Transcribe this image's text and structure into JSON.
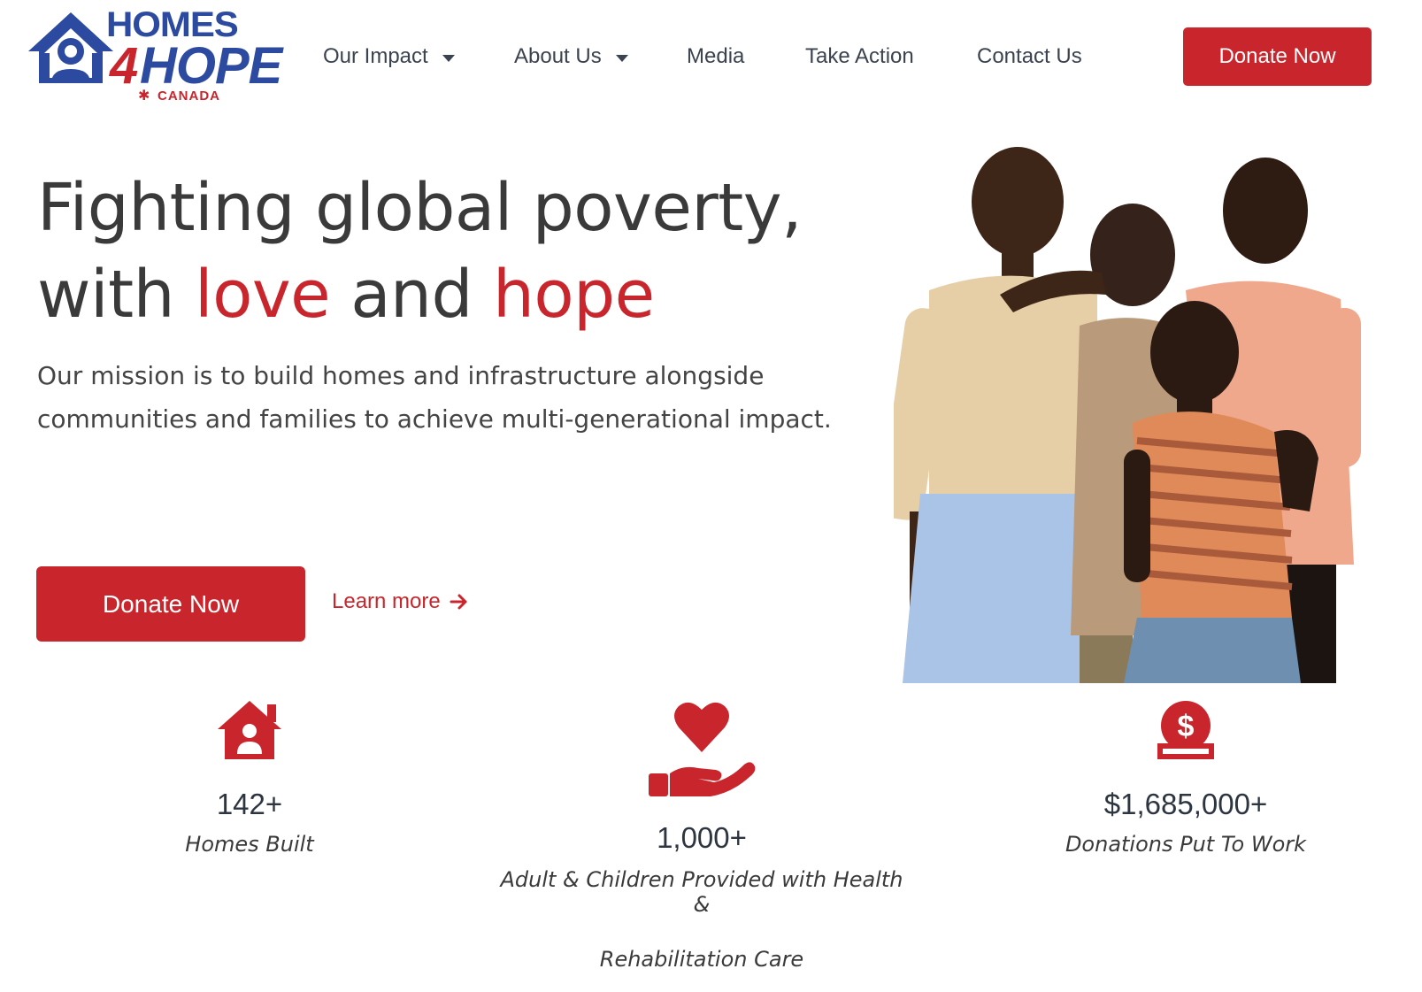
{
  "brand": {
    "logo_line1": "HOMES",
    "logo_digit": "4",
    "logo_line2": "HOPE",
    "logo_country": "CANADA",
    "logo_icon": "house-heart-logo-icon",
    "primary_color": "#c8262c",
    "logo_blue": "#2b4aa0"
  },
  "nav": {
    "items": [
      {
        "label": "Our Impact",
        "has_dropdown": true
      },
      {
        "label": "About Us",
        "has_dropdown": true
      },
      {
        "label": "Media",
        "has_dropdown": false
      },
      {
        "label": "Take Action",
        "has_dropdown": false
      },
      {
        "label": "Contact Us",
        "has_dropdown": false
      }
    ],
    "donate_label": "Donate Now"
  },
  "hero": {
    "title_line1": "Fighting global poverty,",
    "title_with": "with ",
    "title_love": "love",
    "title_and": " and ",
    "title_hope": "hope",
    "description": "Our mission is to build homes and infrastructure alongside communities and families to achieve multi-generational impact.",
    "donate_label": "Donate Now",
    "learn_more_label": "Learn more",
    "learn_more_icon": "arrow-right-icon"
  },
  "stats": [
    {
      "icon": "house-person-icon",
      "value": "142+",
      "label": "Homes Built"
    },
    {
      "icon": "heart-hand-icon",
      "value": "1,000+",
      "label_line1": "Adult & Children Provided with Health &",
      "label_line2": "Rehabilitation Care"
    },
    {
      "icon": "dollar-coin-icon",
      "value": "$1,685,000+",
      "label": "Donations Put To Work"
    }
  ]
}
